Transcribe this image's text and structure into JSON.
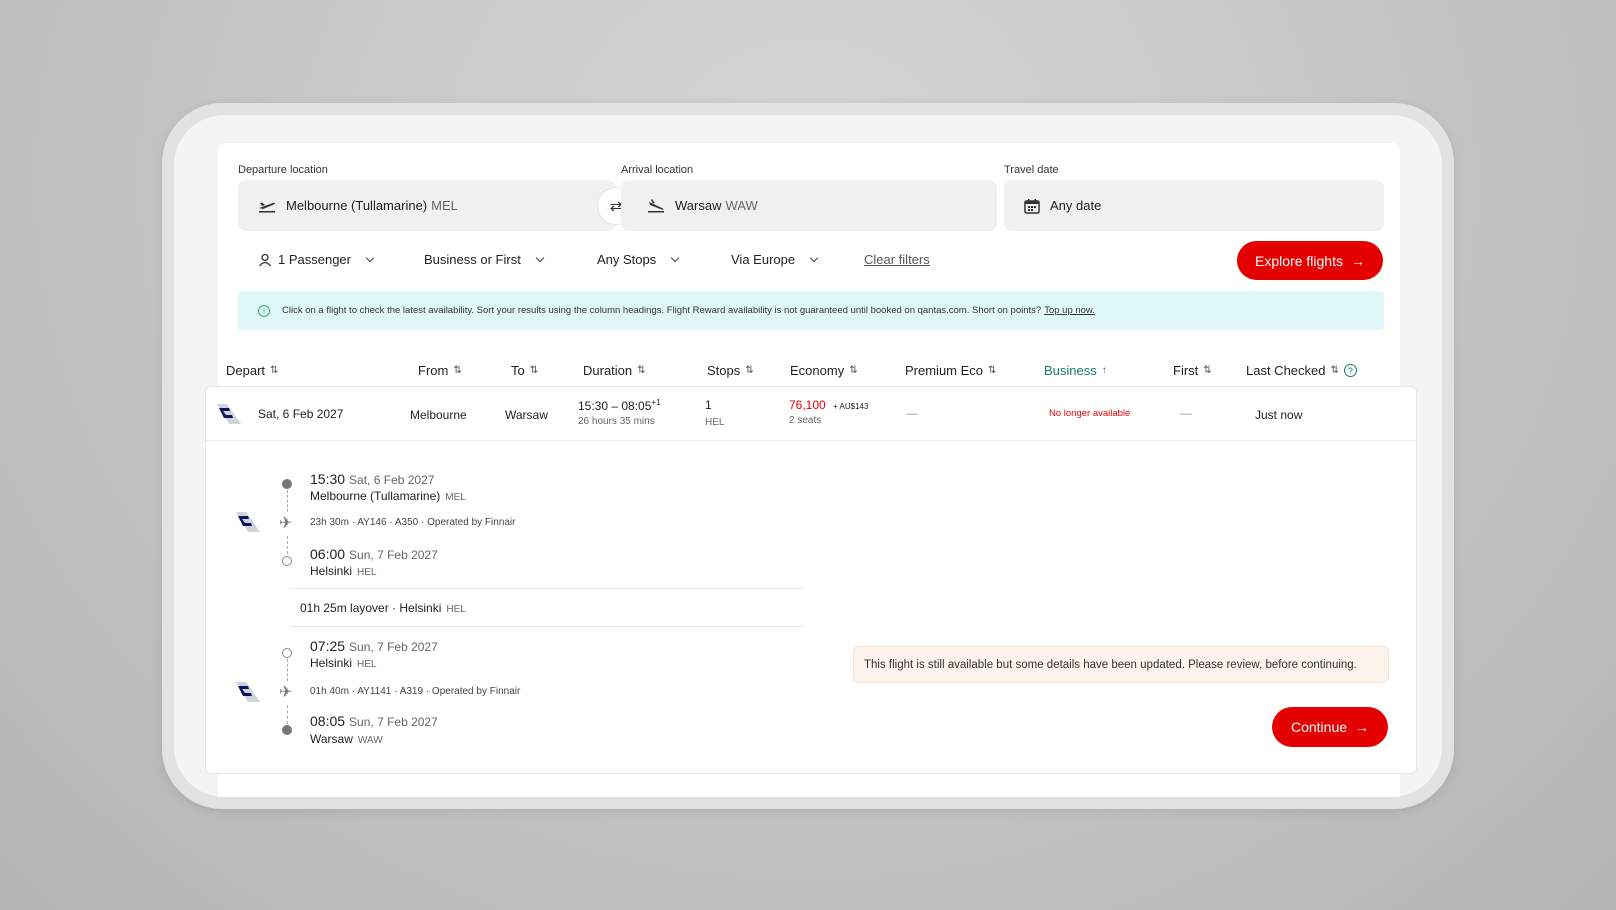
{
  "search": {
    "departure_label": "Departure location",
    "departure_value": "Melbourne (Tullamarine)",
    "departure_code": "MEL",
    "arrival_label": "Arrival location",
    "arrival_value": "Warsaw",
    "arrival_code": "WAW",
    "date_label": "Travel date",
    "date_value": "Any date"
  },
  "filters": {
    "passengers": "1 Passenger",
    "cabin": "Business or First",
    "stops": "Any Stops",
    "via": "Via Europe",
    "clear": "Clear filters",
    "explore": "Explore flights"
  },
  "info": {
    "text": "Click on a flight to check the latest availability. Sort your results using the column headings. Flight Reward availability is not guaranteed until booked on qantas.com. Short on points?",
    "link": "Top up now."
  },
  "columns": [
    "Depart",
    "From",
    "To",
    "Duration",
    "Stops",
    "Economy",
    "Premium Eco",
    "Business",
    "First",
    "Last Checked"
  ],
  "row": {
    "date": "Sat, 6 Feb 2027",
    "from": "Melbourne",
    "to": "Warsaw",
    "time_range": "15:30 – 08:05",
    "day_offset": "+1",
    "duration": "26 hours 35 mins",
    "stops": "1",
    "stop_code": "HEL",
    "economy_points": "76,100",
    "economy_tax": "+ AU$143",
    "economy_seats": "2 seats",
    "premium_eco": "—",
    "business": "No longer available",
    "first": "—",
    "last_checked": "Just now"
  },
  "segments": [
    {
      "dep_time": "15:30",
      "dep_date": "Sat, 6 Feb 2027",
      "dep_place": "Melbourne (Tullamarine)",
      "dep_code": "MEL",
      "meta": "23h 30m · AY146 · A350 · Operated by Finnair",
      "arr_time": "06:00",
      "arr_date": "Sun, 7 Feb 2027",
      "arr_place": "Helsinki",
      "arr_code": "HEL"
    },
    {
      "dep_time": "07:25",
      "dep_date": "Sun, 7 Feb 2027",
      "dep_place": "Helsinki",
      "dep_code": "HEL",
      "meta": "01h 40m · AY1141 · A319 · Operated by Finnair",
      "arr_time": "08:05",
      "arr_date": "Sun, 7 Feb 2027",
      "arr_place": "Warsaw",
      "arr_code": "WAW"
    }
  ],
  "layover": {
    "text": "01h 25m layover  ·  Helsinki",
    "code": "HEL"
  },
  "notice": "This flight is still available but some details have been updated. Please review, before continuing.",
  "continue_label": "Continue",
  "colors": {
    "accent_red": "#e40000",
    "active_sort": "#1a7a6f",
    "info_bg": "#dff7f7",
    "notice_bg": "#fdf3ea"
  }
}
